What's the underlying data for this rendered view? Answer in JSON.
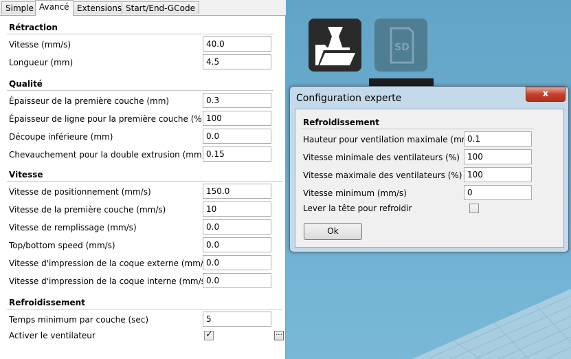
{
  "tabs": [
    "Simple",
    "Avancé",
    "Extensions",
    "Start/End-GCode"
  ],
  "sections": {
    "retraction": {
      "title": "Rétraction",
      "rows": [
        {
          "label": "Vitesse (mm/s)",
          "value": "40.0"
        },
        {
          "label": "Longueur (mm)",
          "value": "4.5"
        }
      ]
    },
    "quality": {
      "title": "Qualité",
      "rows": [
        {
          "label": "Épaisseur de la première couche (mm)",
          "value": "0.3"
        },
        {
          "label": "Épaisseur de ligne pour la première couche (%)",
          "value": "100"
        },
        {
          "label": "Découpe inférieure (mm)",
          "value": "0.0"
        },
        {
          "label": "Chevauchement pour la double extrusion (mm)",
          "value": "0.15"
        }
      ]
    },
    "speed": {
      "title": "Vitesse",
      "rows": [
        {
          "label": "Vitesse de positionnement (mm/s)",
          "value": "150.0"
        },
        {
          "label": "Vitesse de la première couche (mm/s)",
          "value": "10"
        },
        {
          "label": "Vitesse de remplissage (mm/s)",
          "value": "0.0"
        },
        {
          "label": "Top/bottom speed (mm/s)",
          "value": "0.0"
        },
        {
          "label": "Vitesse d'impression de la coque externe (mm/s)",
          "value": "0.0"
        },
        {
          "label": "Vitesse d'impression de la coque interne (mm/s)",
          "value": "0.0"
        }
      ]
    },
    "cooling": {
      "title": "Refroidissement",
      "min_layer_label": "Temps minimum par couche (sec)",
      "min_layer_value": "5",
      "fan_label": "Activer le ventilateur",
      "fan_checked": true,
      "more_label": "..."
    }
  },
  "toolbar": {
    "load_icon": "load-model-icon",
    "sd_icon": "sd-card-icon",
    "sd_text": "SD"
  },
  "dialog": {
    "title": "Configuration experte",
    "close_label": "x",
    "section_title": "Refroidissement",
    "rows": [
      {
        "label": "Hauteur pour ventilation maximale (mm)",
        "value": "0.1"
      },
      {
        "label": "Vitesse minimale des ventilateurs (%)",
        "value": "100"
      },
      {
        "label": "Vitesse maximale des ventilateurs (%)",
        "value": "100"
      },
      {
        "label": "Vitesse minimum (mm/s)",
        "value": "0"
      }
    ],
    "head_lift_label": "Lever la tête pour refroidir",
    "head_lift_checked": false,
    "ok_label": "Ok"
  },
  "colors": {
    "view_background": "#6fa8c6",
    "dialog_frame": "#c4d9ea",
    "close_button": "#c4422b"
  }
}
